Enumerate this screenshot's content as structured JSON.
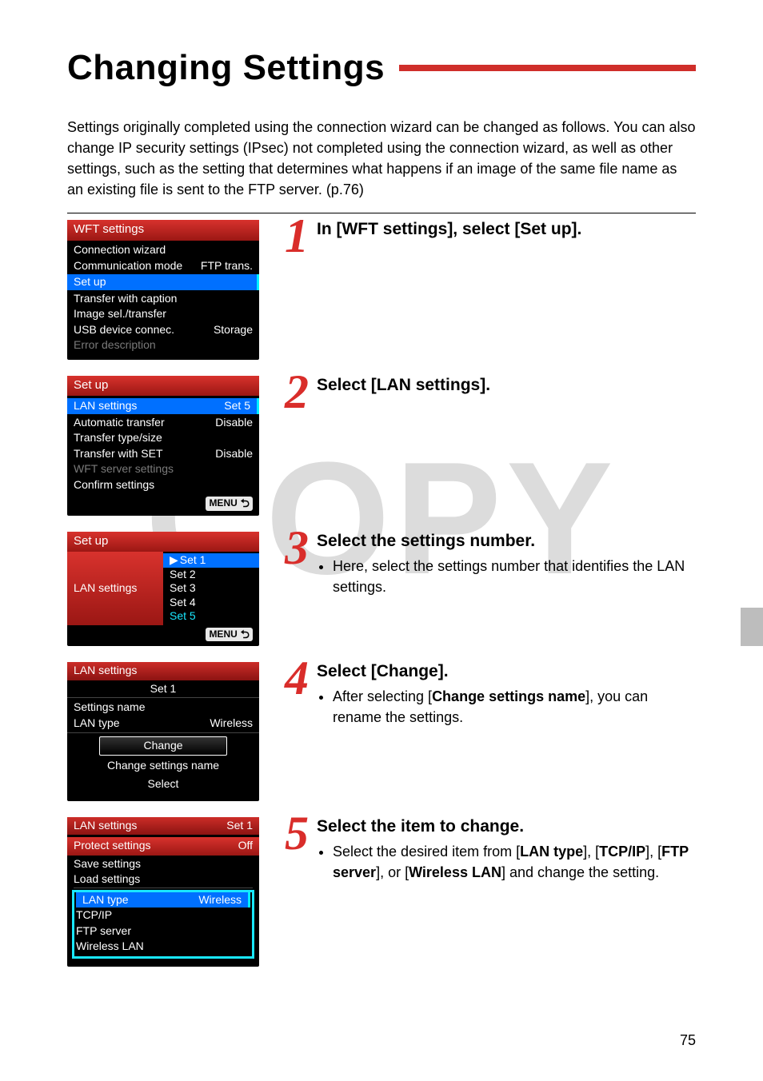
{
  "watermark": "COPY",
  "title": "Changing Settings",
  "intro": "Settings originally completed using the connection wizard can be changed as follows. You can also change IP security settings (IPsec) not completed using the connection wizard, as well as other settings, such as the setting that determines what happens if an image of the same file name as an existing file is sent to the FTP server. (p.76)",
  "page_number": "75",
  "steps": {
    "s1": {
      "num": "1",
      "heading": "In [WFT settings], select [Set up]."
    },
    "s2": {
      "num": "2",
      "heading": "Select [LAN settings]."
    },
    "s3": {
      "num": "3",
      "heading": "Select the settings number.",
      "bullet": "Here, select the settings number that identifies the LAN settings."
    },
    "s4": {
      "num": "4",
      "heading": "Select [Change].",
      "bullet_pre": "After selecting [",
      "bullet_b": "Change settings name",
      "bullet_post": "], you can rename the settings."
    },
    "s5": {
      "num": "5",
      "heading": "Select the item to change.",
      "bullet_pre": "Select the desired item from [",
      "b1": "LAN type",
      "m1": "], [",
      "b2": "TCP/IP",
      "m2": "], [",
      "b3": "FTP server",
      "m3": "], or [",
      "b4": "Wireless LAN",
      "bullet_post": "] and change the setting."
    }
  },
  "screen1": {
    "title": "WFT settings",
    "items": {
      "a": "Connection wizard",
      "b": "Communication mode",
      "b_r": "FTP trans.",
      "c": "Set up",
      "d": "Transfer with caption",
      "e": "Image sel./transfer",
      "f": "USB device connec.",
      "f_r": "Storage",
      "g": "Error description"
    }
  },
  "screen2": {
    "title": "Set up",
    "rows": {
      "a": "LAN settings",
      "a_r": "Set 5",
      "b": "Automatic transfer",
      "b_r": "Disable",
      "c": "Transfer type/size",
      "d": "Transfer with SET",
      "d_r": "Disable",
      "e": "WFT server settings",
      "f": "Confirm settings"
    },
    "menu": "MENU"
  },
  "screen3": {
    "title": "Set up",
    "label": "LAN settings",
    "opts": {
      "o1": "Set 1",
      "o2": "Set 2",
      "o3": "Set 3",
      "o4": "Set 4",
      "o5": "Set 5"
    },
    "menu": "MENU"
  },
  "screen4": {
    "title": "LAN settings",
    "subtitle": "Set 1",
    "rows": {
      "a": "Settings name",
      "b": "LAN type",
      "b_r": "Wireless"
    },
    "pills": {
      "p1": "Change",
      "p2": "Change settings name",
      "p3": "Select"
    }
  },
  "screen5": {
    "title": "LAN settings",
    "title_r": "Set 1",
    "rows": {
      "a": "Protect settings",
      "a_r": "Off",
      "b": "Save settings",
      "c": "Load settings",
      "d": "LAN type",
      "d_r": "Wireless",
      "e": "TCP/IP",
      "f": "FTP server",
      "g": "Wireless LAN"
    }
  }
}
